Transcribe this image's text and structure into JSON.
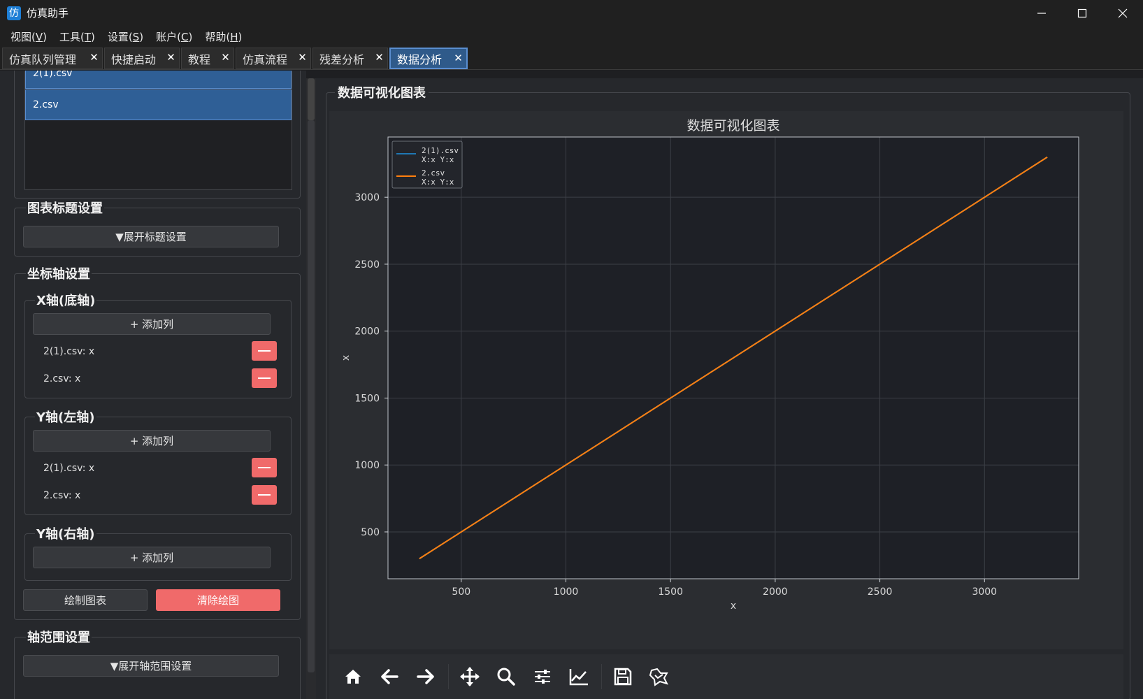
{
  "app": {
    "title": "仿真助手",
    "icon_char": "仿"
  },
  "window_controls": [
    "minimize-icon",
    "maximize-icon",
    "close-icon"
  ],
  "menu": [
    {
      "label": "视图(",
      "mnemonic": "V",
      "end": ")"
    },
    {
      "label": "工具(",
      "mnemonic": "T",
      "end": ")"
    },
    {
      "label": "设置(",
      "mnemonic": "S",
      "end": ")"
    },
    {
      "label": "账户(",
      "mnemonic": "C",
      "end": ")"
    },
    {
      "label": "帮助(",
      "mnemonic": "H",
      "end": ")"
    }
  ],
  "tabs": [
    {
      "label": "仿真队列管理",
      "active": false
    },
    {
      "label": "快捷启动",
      "active": false
    },
    {
      "label": "教程",
      "active": false
    },
    {
      "label": "仿真流程",
      "active": false
    },
    {
      "label": "残差分析",
      "active": false
    },
    {
      "label": "数据分析",
      "active": true
    }
  ],
  "left": {
    "file_list": [
      "2(1).csv",
      "2.csv"
    ],
    "title_settings": {
      "title": "图表标题设置",
      "expand_label": "▼展开标题设置"
    },
    "axis_settings": {
      "title": "坐标轴设置",
      "x_axis": {
        "title": "X轴(底轴)",
        "add_label": "+ 添加列",
        "columns": [
          "2(1).csv: x",
          "2.csv: x"
        ]
      },
      "y_left": {
        "title": "Y轴(左轴)",
        "add_label": "+ 添加列",
        "columns": [
          "2(1).csv: x",
          "2.csv: x"
        ]
      },
      "y_right": {
        "title": "Y轴(右轴)",
        "add_label": "+ 添加列",
        "columns": []
      }
    },
    "plot_button": "绘制图表",
    "clear_button": "清除绘图",
    "range_settings": {
      "title": "轴范围设置",
      "expand_label": "▼展开轴范围设置"
    }
  },
  "chart_group_title": "数据可视化图表",
  "chart_data": {
    "type": "line",
    "title": "数据可视化图表",
    "xlabel": "x",
    "ylabel": "x",
    "xlim": [
      150,
      3450
    ],
    "ylim": [
      150,
      3450
    ],
    "xticks": [
      500,
      1000,
      1500,
      2000,
      2500,
      3000
    ],
    "yticks": [
      500,
      1000,
      1500,
      2000,
      2500,
      3000
    ],
    "grid": true,
    "legend_position": "top-left",
    "series": [
      {
        "name": "2(1).csv",
        "sublabel": "X:x Y:x",
        "color": "#1f77b4",
        "x": [
          300,
          3300
        ],
        "y": [
          300,
          3300
        ]
      },
      {
        "name": "2.csv",
        "sublabel": "X:x Y:x",
        "color": "#ff7f0e",
        "x": [
          300,
          3300
        ],
        "y": [
          300,
          3300
        ]
      }
    ]
  },
  "toolbar": [
    "home-icon",
    "back-icon",
    "forward-icon",
    "pan-icon",
    "zoom-icon",
    "subplots-icon",
    "customize-icon",
    "save-icon",
    "style-icon"
  ],
  "colors": {
    "accent": "#2f5f96",
    "danger": "#f06a6a",
    "background": "#26282c"
  }
}
